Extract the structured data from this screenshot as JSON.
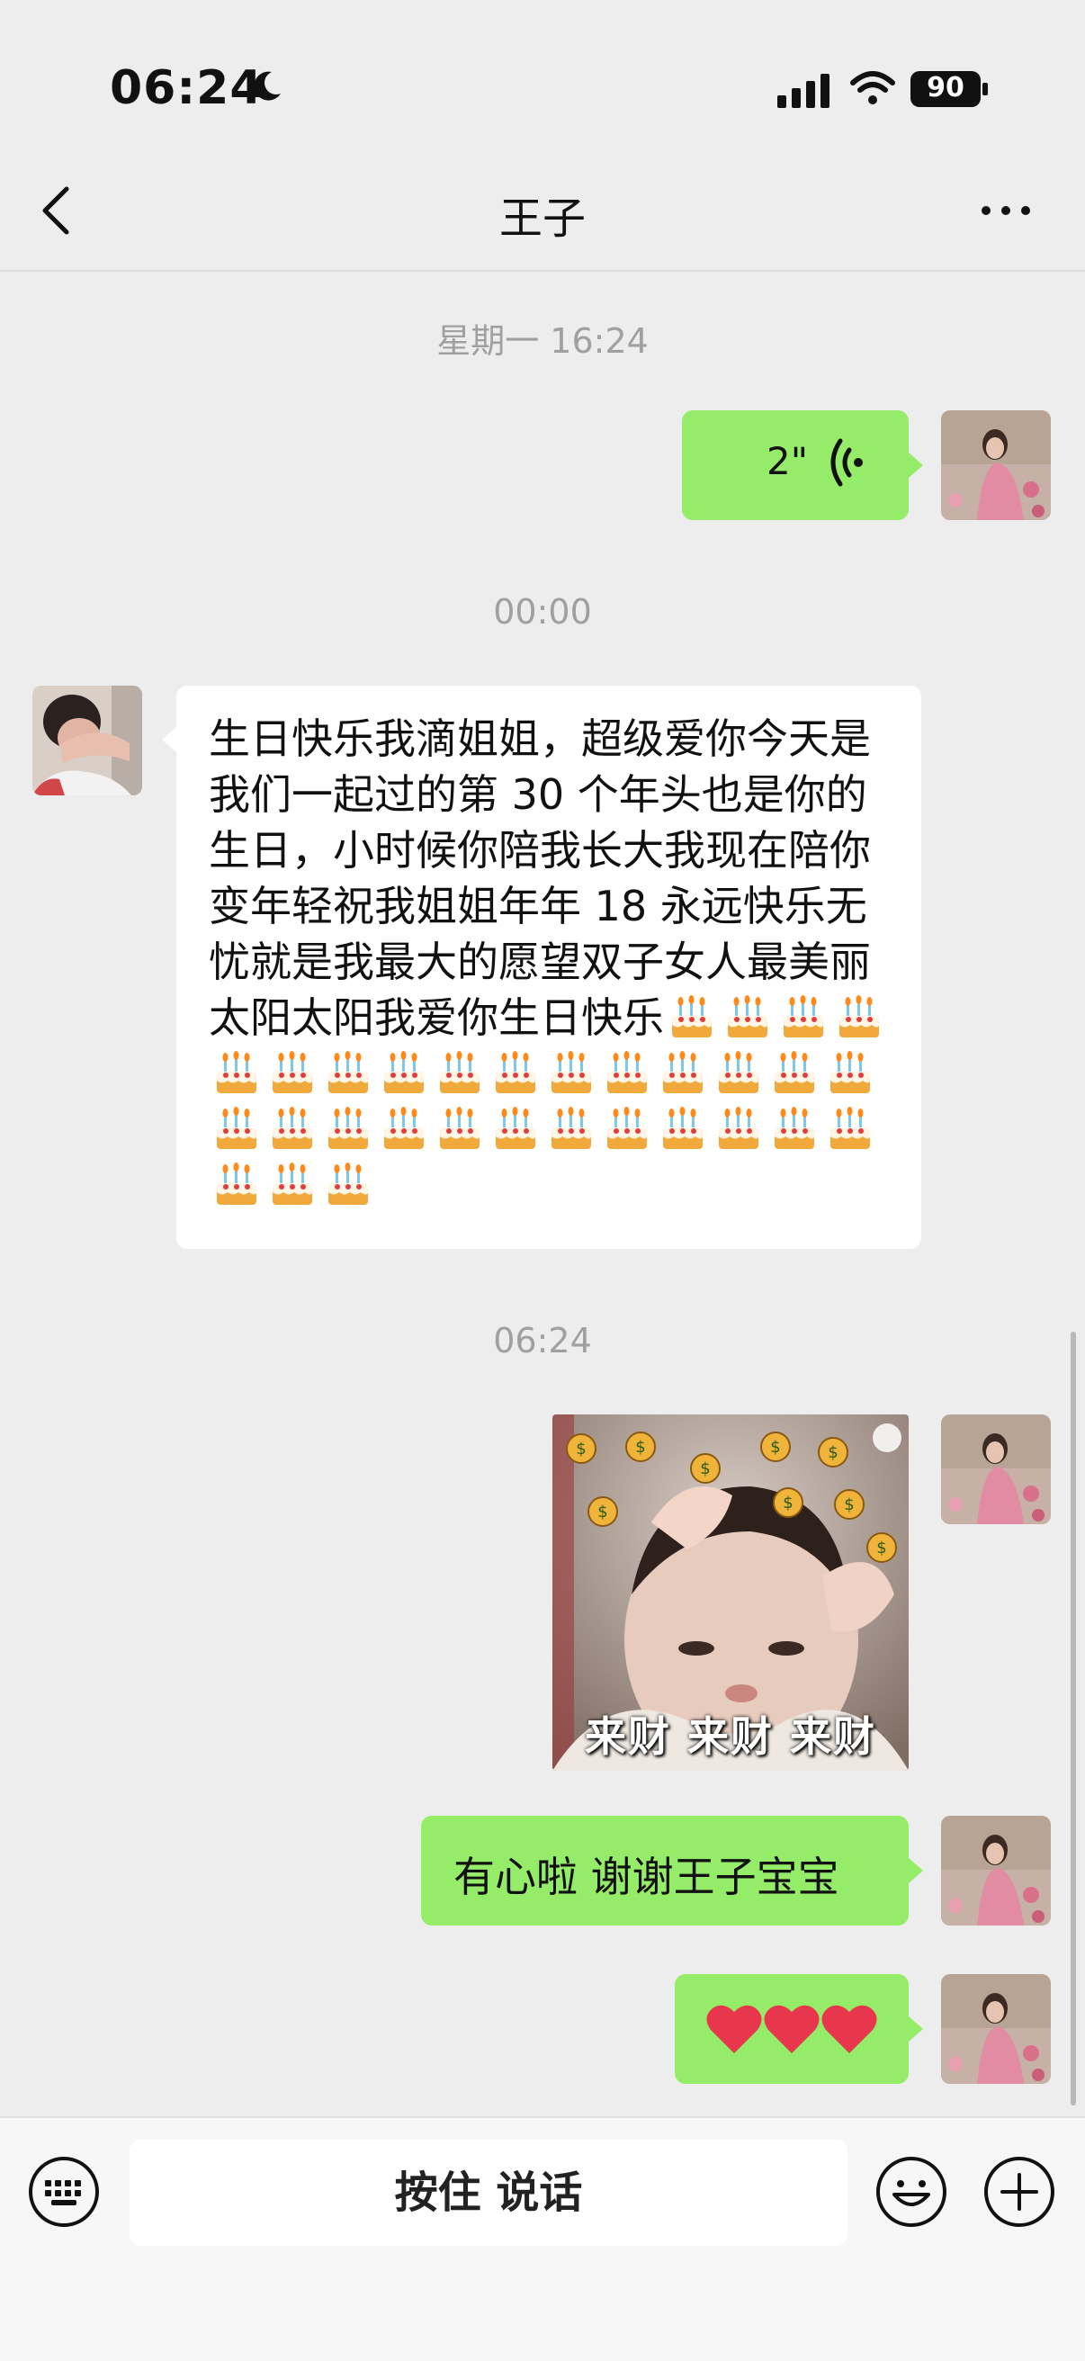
{
  "status_bar": {
    "time": "06:24",
    "battery": "90"
  },
  "header": {
    "title": "王子"
  },
  "messages": {
    "ts1": "星期一 16:24",
    "voice_duration": "2\"",
    "ts2": "00:00",
    "long_text": "生日快乐我滴姐姐，超级爱你今天是我们一起过的第 30 个年头也是你的生日，小时候你陪我长大我现在陪你变年轻祝我姐姐年年 18 永远快乐无忧就是我最大的愿望双子女人最美丽太阳太阳我爱你生日快乐",
    "cake_count": 31,
    "ts3": "06:24",
    "sticker_caption": "来财 来财 来财",
    "reply_text": "有心啦 谢谢王子宝宝",
    "hearts": "❤️❤️❤️"
  },
  "input_bar": {
    "hold_to_talk": "按住 说话"
  },
  "colors": {
    "background": "#ededed",
    "sent_bubble": "#95ec69",
    "received_bubble": "#ffffff",
    "timestamp_text": "#a0a0a0"
  },
  "icons": [
    "moon-icon",
    "signal-icon",
    "wifi-icon",
    "battery-icon",
    "back-icon",
    "more-icon",
    "voice-wave-icon",
    "keyboard-icon",
    "emoji-icon",
    "plus-icon",
    "cake-icon"
  ]
}
